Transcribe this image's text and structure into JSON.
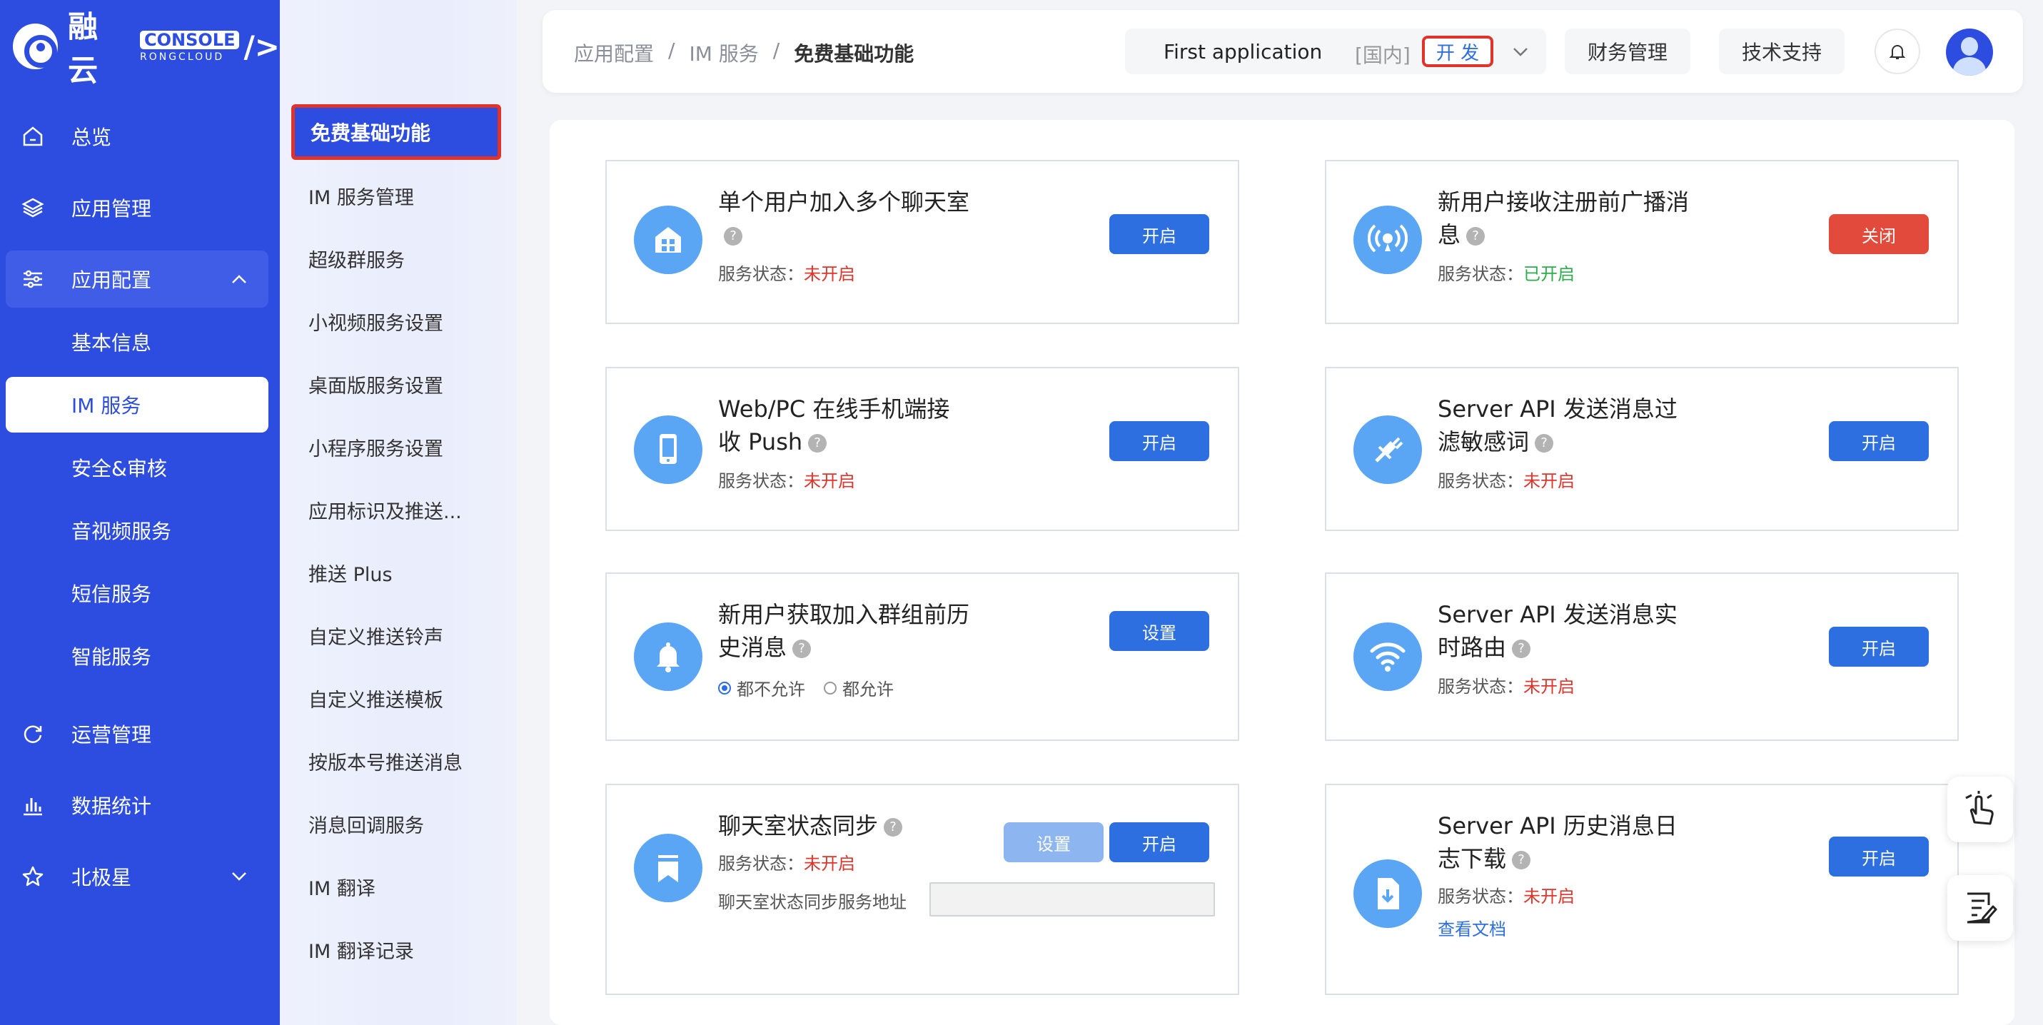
{
  "brand": {
    "name": "融云",
    "console": "CONSOLE",
    "sub": "RONGCLOUD",
    "slash": "/>"
  },
  "nav": {
    "overview": "总览",
    "app_manage": "应用管理",
    "app_config": "应用配置",
    "sub": [
      "基本信息",
      "IM 服务",
      "安全&审核",
      "音视频服务",
      "短信服务",
      "智能服务"
    ],
    "ops": "运营管理",
    "stats": "数据统计",
    "polaris": "北极星"
  },
  "col2": {
    "active": "免费基础功能",
    "items": [
      "IM 服务管理",
      "超级群服务",
      "小视频服务设置",
      "桌面版服务设置",
      "小程序服务设置",
      "应用标识及推送...",
      "推送 Plus",
      "自定义推送铃声",
      "自定义推送模板",
      "按版本号推送消息",
      "消息回调服务",
      "IM 翻译",
      "IM 翻译记录"
    ]
  },
  "header": {
    "breadcrumb": [
      "应用配置",
      "IM 服务",
      "免费基础功能"
    ],
    "sep": "/",
    "app_name": "First application",
    "region": "[国内]",
    "env": "开 发",
    "finance": "财务管理",
    "support": "技术支持"
  },
  "status_label": "服务状态：",
  "cards": {
    "c1": {
      "title": "单个用户加入多个聊天室",
      "status": "未开启",
      "btn": "开启"
    },
    "c2": {
      "title_l1": "新用户接收注册前广播消",
      "title_l2": "息",
      "status": "已开启",
      "btn": "关闭"
    },
    "c3": {
      "title_l1": "Web/PC 在线手机端接",
      "title_l2": "收 Push",
      "status": "未开启",
      "btn": "开启"
    },
    "c4": {
      "title_l1": "Server API 发送消息过",
      "title_l2": "滤敏感词",
      "status": "未开启",
      "btn": "开启"
    },
    "c5": {
      "title_l1": "新用户获取加入群组前历",
      "title_l2": "史消息",
      "radio1": "都不允许",
      "radio2": "都允许",
      "btn": "设置"
    },
    "c6": {
      "title_l1": "Server API 发送消息实",
      "title_l2": "时路由",
      "status": "未开启",
      "btn": "开启"
    },
    "c7": {
      "title": "聊天室状态同步",
      "status": "未开启",
      "btn_set": "设置",
      "btn_on": "开启",
      "addr_label": "聊天室状态同步服务地址",
      "addr_value": ""
    },
    "c8": {
      "title_l1": "Server API 历史消息日",
      "title_l2": "志下载",
      "status": "未开启",
      "btn": "开启",
      "link": "查看文档"
    }
  },
  "colors": {
    "primary": "#2d4de0",
    "button": "#2d6fe0",
    "danger": "#e24a3b",
    "success": "#2bae4a",
    "icon_bg": "#5aa6f5"
  }
}
